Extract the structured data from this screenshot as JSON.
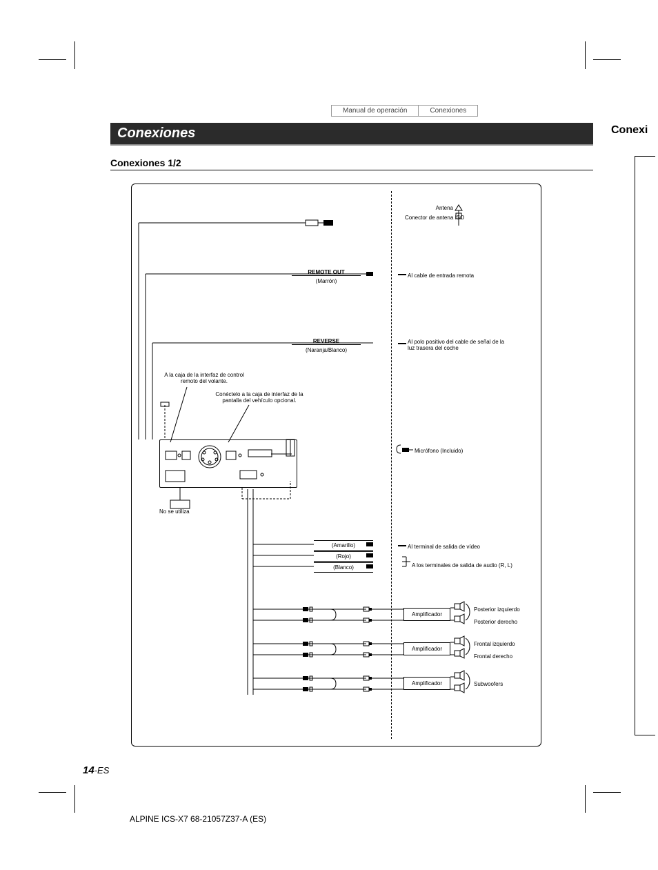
{
  "header": {
    "tab1": "Manual de operación",
    "tab2": "Conexiones"
  },
  "section": {
    "title": "Conexiones",
    "subtitle": "Conexiones 1/2",
    "side_cut": "Conexi"
  },
  "diagram": {
    "antenna": "Antena",
    "iso_antenna": "Conector de antena ISO",
    "remote_out": "REMOTE OUT",
    "remote_out_color": "(Marrón)",
    "remote_in_cable": "Al cable de entrada remota",
    "reverse": "REVERSE",
    "reverse_color": "(Naranja/Blanco)",
    "reverse_target": "Al polo positivo del cable de señal de la luz trasera del coche",
    "swrc_box": "A la caja de la interfaz de control remoto del volante.",
    "display_interface": "Conéctelo a la caja de interfaz de la pantalla del vehículo opcional.",
    "mic": "Micrófono (Incluido)",
    "not_used": "No se utiliza",
    "yellow": "(Amarillo)",
    "red": "(Rojo)",
    "white": "(Blanco)",
    "video_out": "Al terminal de salida de vídeo",
    "audio_out": "A los terminales de salida de audio (R, L)",
    "amp": "Amplificador",
    "rear_left": "Posterior izquierdo",
    "rear_right": "Posterior derecho",
    "front_left": "Frontal izquierdo",
    "front_right": "Frontal derecho",
    "subwoofers": "Subwoofers"
  },
  "footer": {
    "page_num_big": "14",
    "page_num_suffix": "-ES",
    "code": "ALPINE ICS-X7 68-21057Z37-A (ES)"
  }
}
